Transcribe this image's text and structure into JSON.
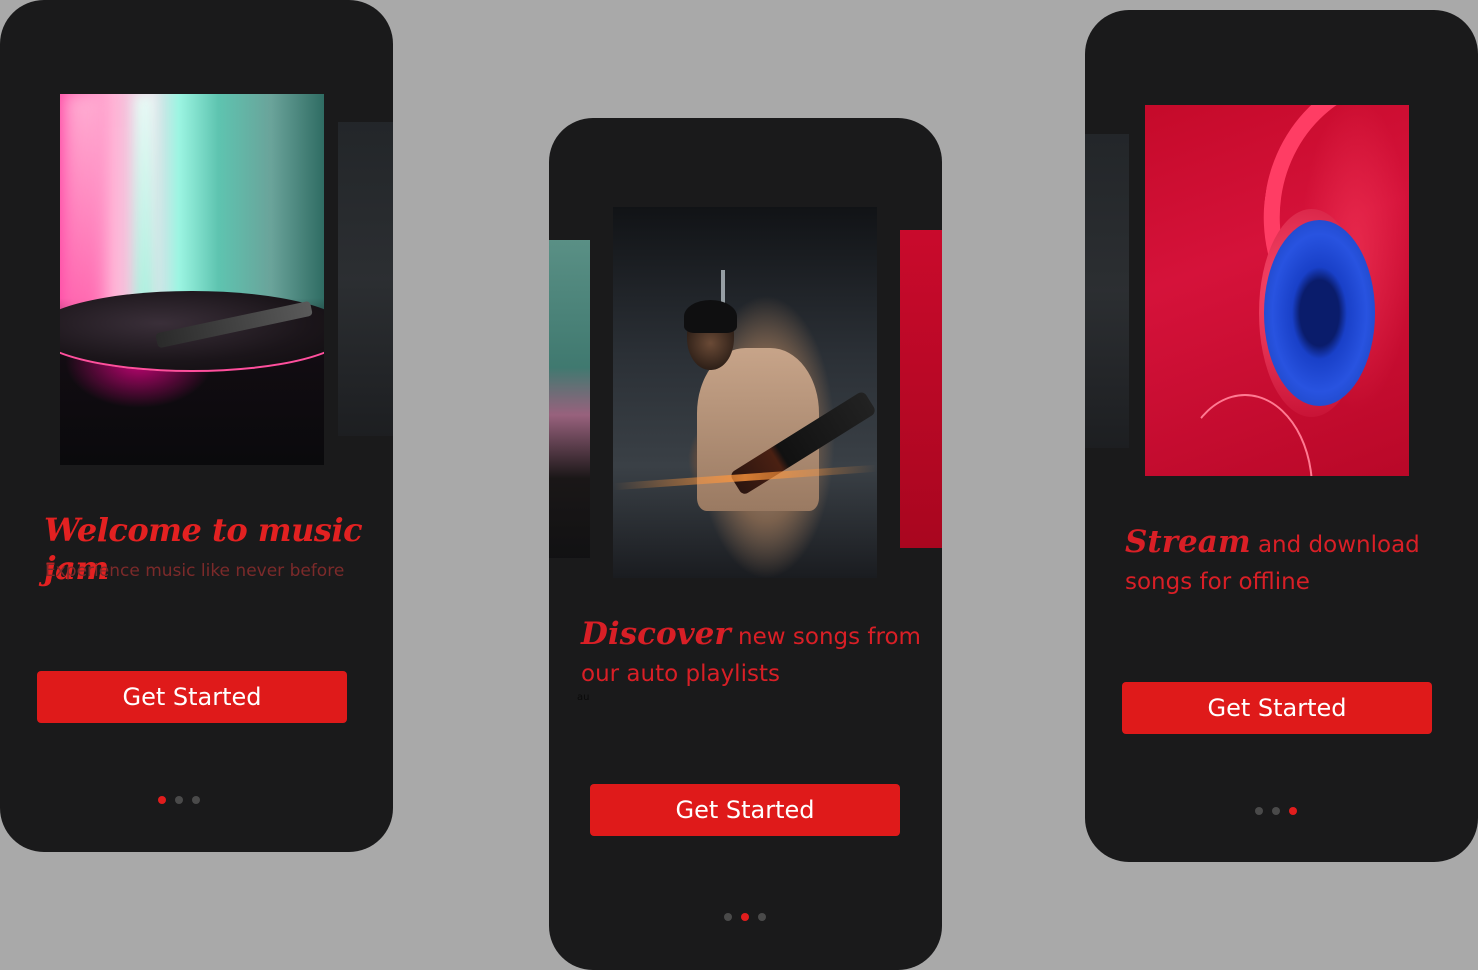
{
  "colors": {
    "canvas": "#a9a9a9",
    "screen_bg": "#1a1a1b",
    "accent": "#e32121",
    "button_bg": "#df1a1a",
    "button_text": "#ffffff",
    "subtitle": "#7c2a2a",
    "dot_inactive": "#4a4a4a"
  },
  "screens": [
    {
      "title": "Welcome to music jam",
      "subtitle": "Experience music like never before",
      "button_label": "Get Started",
      "active_dot": 0,
      "dot_count": 3
    },
    {
      "title_strong": "Discover",
      "title_rest": " new songs from our auto playlists",
      "stray_text": "au",
      "button_label": "Get Started",
      "active_dot": 1,
      "dot_count": 3
    },
    {
      "title_strong": "Stream",
      "title_rest": " and download songs for offline",
      "button_label": "Get Started",
      "active_dot": 2,
      "dot_count": 3
    }
  ]
}
